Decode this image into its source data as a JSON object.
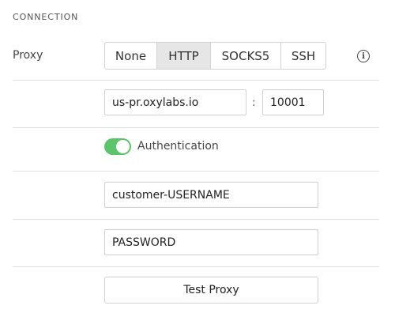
{
  "section": {
    "title": "CONNECTION"
  },
  "proxy": {
    "label": "Proxy",
    "types": [
      "None",
      "HTTP",
      "SOCKS5",
      "SSH"
    ],
    "selected": "HTTP",
    "info_icon": "info-icon"
  },
  "host": {
    "value": "us-pr.oxylabs.io",
    "separator": ":"
  },
  "port": {
    "value": "10001"
  },
  "auth": {
    "label": "Authentication",
    "enabled": true,
    "color": "#5cc46a"
  },
  "username": {
    "value": "customer-USERNAME"
  },
  "password": {
    "value": "PASSWORD"
  },
  "test_button": {
    "label": "Test Proxy"
  }
}
